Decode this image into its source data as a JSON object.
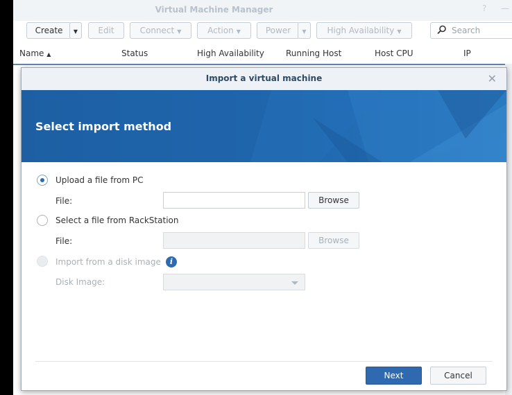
{
  "app": {
    "title": "Virtual Machine Manager",
    "window_controls": [
      "?",
      "—"
    ]
  },
  "toolbar": {
    "create": "Create",
    "edit": "Edit",
    "connect": "Connect",
    "action": "Action",
    "power": "Power",
    "high_availability": "High Availability",
    "search_placeholder": "Search"
  },
  "table": {
    "columns": [
      "Name",
      "Status",
      "High Availability",
      "Running Host",
      "Host CPU",
      "IP"
    ],
    "sort_indicator": "▲"
  },
  "dialog": {
    "title": "Import a virtual machine",
    "heading": "Select import method",
    "options": [
      {
        "label": "Upload a file from PC",
        "selected": true,
        "enabled": true
      },
      {
        "label": "Select a file from RackStation",
        "selected": false,
        "enabled": true
      },
      {
        "label": "Import from a disk image",
        "selected": false,
        "enabled": false
      }
    ],
    "file_label": "File:",
    "browse_label": "Browse",
    "disk_image_label": "Disk Image:",
    "info_icon": "i",
    "next_label": "Next",
    "cancel_label": "Cancel"
  },
  "colors": {
    "accent": "#2f6ab0",
    "banner": "#1f66ad",
    "table_header_line": "#5b86b4"
  }
}
